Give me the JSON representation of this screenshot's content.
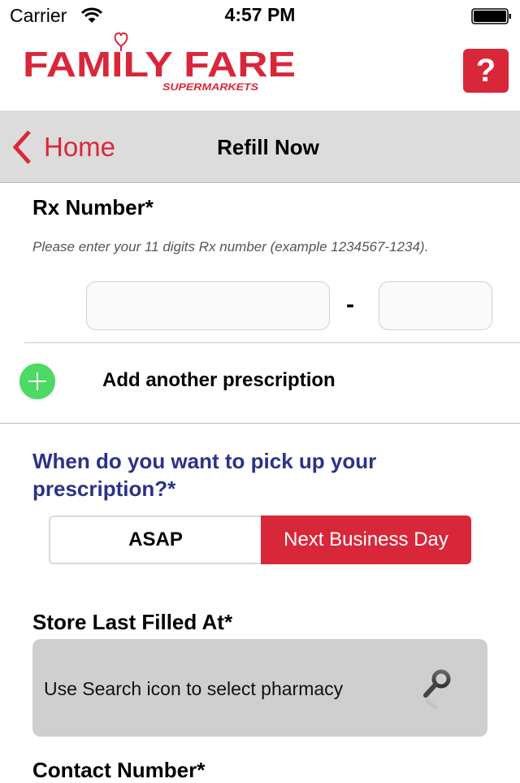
{
  "status_bar": {
    "carrier": "Carrier",
    "time": "4:57 PM",
    "wifi_icon": "wifi-icon",
    "battery_icon": "battery-full-icon"
  },
  "header": {
    "brand_primary": "FAMILY FARE",
    "brand_secondary": "SUPERMARKETS",
    "help_label": "?",
    "brand_color": "#d9273a"
  },
  "nav": {
    "back_label": "Home",
    "title": "Refill Now"
  },
  "rx": {
    "label": "Rx Number*",
    "hint": "Please enter your 11 digits Rx number (example 1234567-1234).",
    "main_value": "",
    "suffix_value": "",
    "separator": "-"
  },
  "add_prescription": {
    "label": "Add another prescription",
    "icon": "plus-circle-icon",
    "icon_color": "#4cd964"
  },
  "pickup": {
    "question": "When do you want to pick up your prescription?*",
    "question_color": "#2b3288",
    "options": [
      {
        "label": "ASAP",
        "selected": false
      },
      {
        "label": "Next Business Day",
        "selected": true
      }
    ]
  },
  "store": {
    "label": "Store Last Filled At*",
    "placeholder": "Use Search icon to select pharmacy",
    "icon": "search-icon"
  },
  "contact": {
    "label": "Contact Number*"
  }
}
